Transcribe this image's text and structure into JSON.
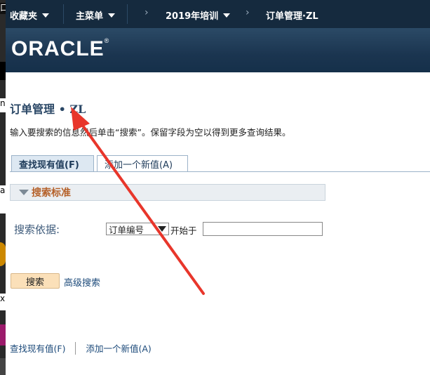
{
  "left_strip": {
    "glyphs": [
      "口",
      "",
      "n",
      "a",
      "",
      "x",
      "",
      ""
    ]
  },
  "topnav": {
    "favorites": "收藏夹",
    "main_menu": "主菜单",
    "crumb1": "2019年培训",
    "crumb2": "订单管理·ZL"
  },
  "banner": {
    "logo_text": "ORACLE",
    "reg_mark": "®"
  },
  "page": {
    "title": "订单管理 • ZL",
    "instructions": "输入要搜索的信息然后单击“搜索”。保留字段为空以得到更多查询结果。"
  },
  "tabs": [
    {
      "label": "查找现有值(F)",
      "active": true
    },
    {
      "label": "添加一个新值(A)",
      "active": false
    }
  ],
  "search": {
    "section_title": "搜索标准",
    "search_by_label": "搜索依据:",
    "field_selected": "订单编号",
    "operator": "开始于",
    "input_value": "",
    "search_button": "搜索",
    "advanced_link": "高级搜索"
  },
  "footer_links": {
    "find": "查找现有值(F)",
    "add": "添加一个新值(A)"
  },
  "colors": {
    "nav_bg": "#152a3e",
    "title_blue": "#2a4766",
    "section_orange": "#b5612a",
    "annotation_red": "#e8362b"
  }
}
